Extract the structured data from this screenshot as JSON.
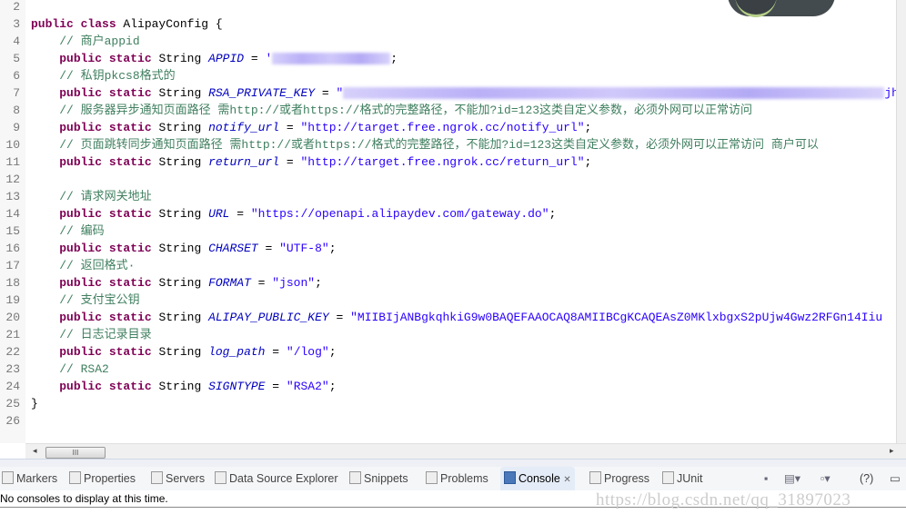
{
  "editor": {
    "lines": [
      {
        "n": "2"
      },
      {
        "n": "3",
        "class_kw": "public class",
        "class_name": " AlipayConfig {"
      },
      {
        "n": "4",
        "comment": "// 商户appid"
      },
      {
        "n": "5",
        "kw": "public static",
        "type": " String ",
        "field": "APPID",
        "eq": " = ",
        "str_pre": "'",
        "str_post": "",
        "end": ";"
      },
      {
        "n": "6",
        "comment": "// 私钥pkcs8格式的"
      },
      {
        "n": "7",
        "kw": "public static",
        "type": " String ",
        "field": "RSA_PRIVATE_KEY",
        "eq": " = ",
        "str_pre": "\"",
        "str_post": "jh"
      },
      {
        "n": "8",
        "comment": "// 服务器异步通知页面路径 需http://或者https://格式的完整路径，不能加?id=123这类自定义参数，必须外网可以正常访问"
      },
      {
        "n": "9",
        "kw": "public static",
        "type": " String ",
        "field": "notify_url",
        "eq": " = ",
        "str": "\"http://target.free.ngrok.cc/notify_url\"",
        "end": ";"
      },
      {
        "n": "10",
        "comment": "// 页面跳转同步通知页面路径 需http://或者https://格式的完整路径，不能加?id=123这类自定义参数，必须外网可以正常访问 商户可以"
      },
      {
        "n": "11",
        "kw": "public static",
        "type": " String ",
        "field": "return_url",
        "eq": " = ",
        "str": "\"http://target.free.ngrok.cc/return_url\"",
        "end": ";"
      },
      {
        "n": "12"
      },
      {
        "n": "13",
        "comment": "// 请求网关地址"
      },
      {
        "n": "14",
        "kw": "public static",
        "type": " String ",
        "field": "URL",
        "eq": " = ",
        "str": "\"https://openapi.alipaydev.com/gateway.do\"",
        "end": ";"
      },
      {
        "n": "15",
        "comment": "// 编码"
      },
      {
        "n": "16",
        "kw": "public static",
        "type": " String ",
        "field": "CHARSET",
        "eq": " = ",
        "str": "\"UTF-8\"",
        "end": ";"
      },
      {
        "n": "17",
        "comment": "// 返回格式·"
      },
      {
        "n": "18",
        "kw": "public static",
        "type": " String ",
        "field": "FORMAT",
        "eq": " = ",
        "str": "\"json\"",
        "end": ";"
      },
      {
        "n": "19",
        "comment": "// 支付宝公钥"
      },
      {
        "n": "20",
        "kw": "public static",
        "type": " String ",
        "field": "ALIPAY_PUBLIC_KEY",
        "eq": " = ",
        "str": "\"MIIBIjANBgkqhkiG9w0BAQEFAAOCAQ8AMIIBCgKCAQEAsZ0MKlxbgxS2pUjw4Gwz2RFGn14Iiu"
      },
      {
        "n": "21",
        "comment": "// 日志记录目录"
      },
      {
        "n": "22",
        "kw": "public static",
        "type": " String ",
        "field": "log_path",
        "eq": " = ",
        "str": "\"/log\"",
        "end": ";"
      },
      {
        "n": "23",
        "comment": "// RSA2"
      },
      {
        "n": "24",
        "kw": "public static",
        "type": " String ",
        "field": "SIGNTYPE",
        "eq": " = ",
        "str": "\"RSA2\"",
        "end": ";"
      },
      {
        "n": "25",
        "close": "}"
      },
      {
        "n": "26"
      }
    ]
  },
  "scrollbar": {
    "thumb_label": "III"
  },
  "bottom_tabs": [
    {
      "label": "Markers",
      "icon": "markers-icon"
    },
    {
      "label": "Properties",
      "icon": "properties-icon"
    },
    {
      "label": "Servers",
      "icon": "servers-icon"
    },
    {
      "label": "Data Source Explorer",
      "icon": "data-source-icon"
    },
    {
      "label": "Snippets",
      "icon": "snippets-icon"
    },
    {
      "label": "Problems",
      "icon": "problems-icon"
    },
    {
      "label": "Console",
      "icon": "console-icon",
      "active": true,
      "close": "✕"
    },
    {
      "label": "Progress",
      "icon": "progress-icon"
    },
    {
      "label": "JUnit",
      "icon": "junit-icon"
    }
  ],
  "toolbar": {
    "help_label": "(?)"
  },
  "console": {
    "message": "No consoles to display at this time."
  },
  "watermark": "https://blog.csdn.net/qq_31897023"
}
